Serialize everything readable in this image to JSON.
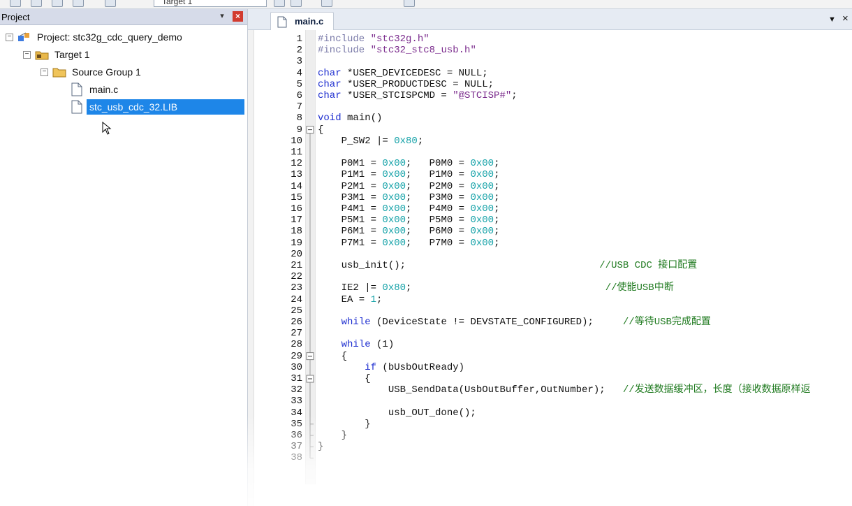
{
  "toolbar": {
    "target_label": "Target 1"
  },
  "project_panel": {
    "title": "Project",
    "tree": {
      "project": "Project: stc32g_cdc_query_demo",
      "target": "Target 1",
      "group": "Source Group 1",
      "files": [
        "main.c",
        "stc_usb_cdc_32.LIB"
      ]
    }
  },
  "editor": {
    "tab": "main.c",
    "lines": [
      {
        "n": "1",
        "t": [
          [
            "pp",
            "#include "
          ],
          [
            "str",
            "\"stc32g.h\""
          ]
        ]
      },
      {
        "n": "2",
        "t": [
          [
            "pp",
            "#include "
          ],
          [
            "str",
            "\"stc32_stc8_usb.h\""
          ]
        ]
      },
      {
        "n": "3",
        "t": []
      },
      {
        "n": "4",
        "t": [
          [
            "kw",
            "char"
          ],
          [
            "",
            " *USER_DEVICEDESC = NULL;"
          ]
        ]
      },
      {
        "n": "5",
        "t": [
          [
            "kw",
            "char"
          ],
          [
            "",
            " *USER_PRODUCTDESC = NULL;"
          ]
        ]
      },
      {
        "n": "6",
        "t": [
          [
            "kw",
            "char"
          ],
          [
            "",
            " *USER_STCISPCMD = "
          ],
          [
            "str",
            "\"@STCISP#\""
          ],
          [
            "",
            ";"
          ]
        ]
      },
      {
        "n": "7",
        "t": []
      },
      {
        "n": "8",
        "t": [
          [
            "kw",
            "void"
          ],
          [
            "",
            " main()"
          ]
        ]
      },
      {
        "n": "9",
        "t": [
          [
            "",
            "{"
          ]
        ]
      },
      {
        "n": "10",
        "t": [
          [
            "",
            "    P_SW2 |= "
          ],
          [
            "num",
            "0x80"
          ],
          [
            "",
            ";"
          ]
        ]
      },
      {
        "n": "11",
        "t": []
      },
      {
        "n": "12",
        "t": [
          [
            "",
            "    P0M1 = "
          ],
          [
            "num",
            "0x00"
          ],
          [
            "",
            ";   P0M0 = "
          ],
          [
            "num",
            "0x00"
          ],
          [
            "",
            ";"
          ]
        ]
      },
      {
        "n": "13",
        "t": [
          [
            "",
            "    P1M1 = "
          ],
          [
            "num",
            "0x00"
          ],
          [
            "",
            ";   P1M0 = "
          ],
          [
            "num",
            "0x00"
          ],
          [
            "",
            ";"
          ]
        ]
      },
      {
        "n": "14",
        "t": [
          [
            "",
            "    P2M1 = "
          ],
          [
            "num",
            "0x00"
          ],
          [
            "",
            ";   P2M0 = "
          ],
          [
            "num",
            "0x00"
          ],
          [
            "",
            ";"
          ]
        ]
      },
      {
        "n": "15",
        "t": [
          [
            "",
            "    P3M1 = "
          ],
          [
            "num",
            "0x00"
          ],
          [
            "",
            ";   P3M0 = "
          ],
          [
            "num",
            "0x00"
          ],
          [
            "",
            ";"
          ]
        ]
      },
      {
        "n": "16",
        "t": [
          [
            "",
            "    P4M1 = "
          ],
          [
            "num",
            "0x00"
          ],
          [
            "",
            ";   P4M0 = "
          ],
          [
            "num",
            "0x00"
          ],
          [
            "",
            ";"
          ]
        ]
      },
      {
        "n": "17",
        "t": [
          [
            "",
            "    P5M1 = "
          ],
          [
            "num",
            "0x00"
          ],
          [
            "",
            ";   P5M0 = "
          ],
          [
            "num",
            "0x00"
          ],
          [
            "",
            ";"
          ]
        ]
      },
      {
        "n": "18",
        "t": [
          [
            "",
            "    P6M1 = "
          ],
          [
            "num",
            "0x00"
          ],
          [
            "",
            ";   P6M0 = "
          ],
          [
            "num",
            "0x00"
          ],
          [
            "",
            ";"
          ]
        ]
      },
      {
        "n": "19",
        "t": [
          [
            "",
            "    P7M1 = "
          ],
          [
            "num",
            "0x00"
          ],
          [
            "",
            ";   P7M0 = "
          ],
          [
            "num",
            "0x00"
          ],
          [
            "",
            ";"
          ]
        ]
      },
      {
        "n": "20",
        "t": []
      },
      {
        "n": "21",
        "t": [
          [
            "",
            "    usb_init();                                 "
          ],
          [
            "cm",
            "//USB CDC 接口配置"
          ]
        ]
      },
      {
        "n": "22",
        "t": []
      },
      {
        "n": "23",
        "t": [
          [
            "",
            "    IE2 |= "
          ],
          [
            "num",
            "0x80"
          ],
          [
            "",
            ";                                 "
          ],
          [
            "cm",
            "//使能USB中断"
          ]
        ]
      },
      {
        "n": "24",
        "t": [
          [
            "",
            "    EA = "
          ],
          [
            "num",
            "1"
          ],
          [
            "",
            ";"
          ]
        ]
      },
      {
        "n": "25",
        "t": []
      },
      {
        "n": "26",
        "t": [
          [
            "",
            "    "
          ],
          [
            "kw",
            "while"
          ],
          [
            "",
            " (DeviceState != DEVSTATE_CONFIGURED);     "
          ],
          [
            "cm",
            "//等待USB完成配置"
          ]
        ]
      },
      {
        "n": "27",
        "t": []
      },
      {
        "n": "28",
        "t": [
          [
            "",
            "    "
          ],
          [
            "kw",
            "while"
          ],
          [
            "",
            " (1)"
          ]
        ]
      },
      {
        "n": "29",
        "t": [
          [
            "",
            "    {"
          ]
        ]
      },
      {
        "n": "30",
        "t": [
          [
            "",
            "        "
          ],
          [
            "kw",
            "if"
          ],
          [
            "",
            " (bUsbOutReady)"
          ]
        ]
      },
      {
        "n": "31",
        "t": [
          [
            "",
            "        {"
          ]
        ]
      },
      {
        "n": "32",
        "t": [
          [
            "",
            "            USB_SendData(UsbOutBuffer,OutNumber);   "
          ],
          [
            "cm",
            "//发送数据缓冲区，长度（接收数据原样返"
          ]
        ]
      },
      {
        "n": "33",
        "t": []
      },
      {
        "n": "34",
        "t": [
          [
            "",
            "            usb_OUT_done();"
          ]
        ]
      },
      {
        "n": "35",
        "t": [
          [
            "",
            "        }"
          ]
        ]
      },
      {
        "n": "36",
        "t": [
          [
            "",
            "    }"
          ]
        ]
      },
      {
        "n": "37",
        "t": [
          [
            "",
            "}"
          ]
        ]
      },
      {
        "n": "38",
        "t": []
      }
    ]
  },
  "icons": [
    "pin-icon",
    "close-icon",
    "project-icon",
    "target-folder-icon",
    "folder-icon",
    "file-icon",
    "cursor-icon",
    "dropdown-icon"
  ],
  "colors": {
    "keyword": "#1f2fd0",
    "number": "#15a2a8",
    "string": "#7a2a8c",
    "comment": "#1f7a1f",
    "preprocessor": "#7a7aa8",
    "selection": "#1e86e8"
  }
}
